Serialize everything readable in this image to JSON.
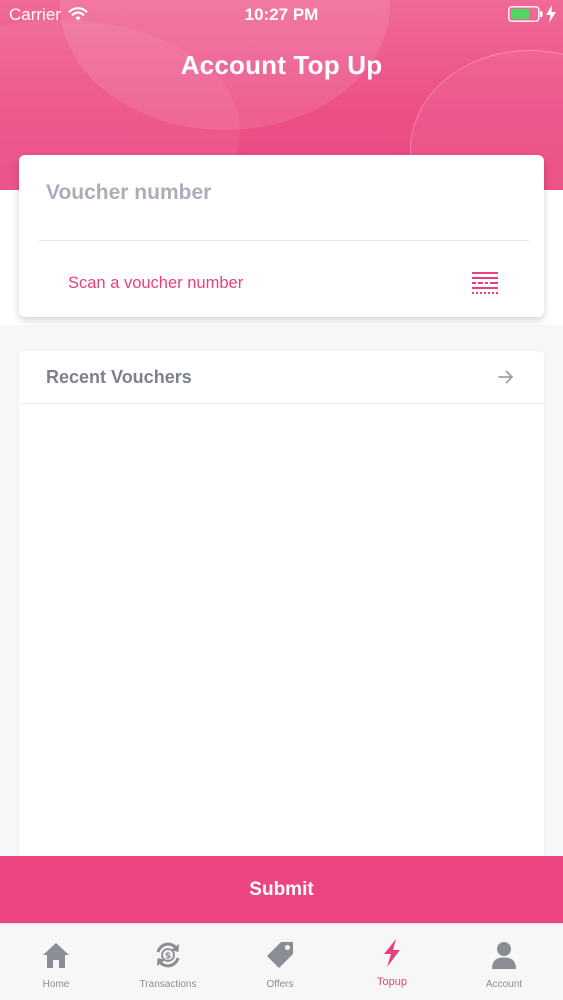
{
  "status_bar": {
    "carrier": "Carrier",
    "time": "10:27 PM"
  },
  "header": {
    "title": "Account Top Up"
  },
  "voucher": {
    "placeholder": "Voucher number",
    "value": "",
    "scan_label": "Scan a voucher number"
  },
  "recent": {
    "title": "Recent Vouchers",
    "items": []
  },
  "submit_label": "Submit",
  "tabs": [
    {
      "label": "Home",
      "icon": "home-icon",
      "active": false
    },
    {
      "label": "Transactions",
      "icon": "transactions-icon",
      "active": false
    },
    {
      "label": "Offers",
      "icon": "tag-icon",
      "active": false
    },
    {
      "label": "Topup",
      "icon": "bolt-icon",
      "active": true
    },
    {
      "label": "Account",
      "icon": "user-icon",
      "active": false
    }
  ],
  "colors": {
    "accent": "#ec4581",
    "header_gradient_top": "#f06a97",
    "inactive_tab": "#8a8d93"
  }
}
